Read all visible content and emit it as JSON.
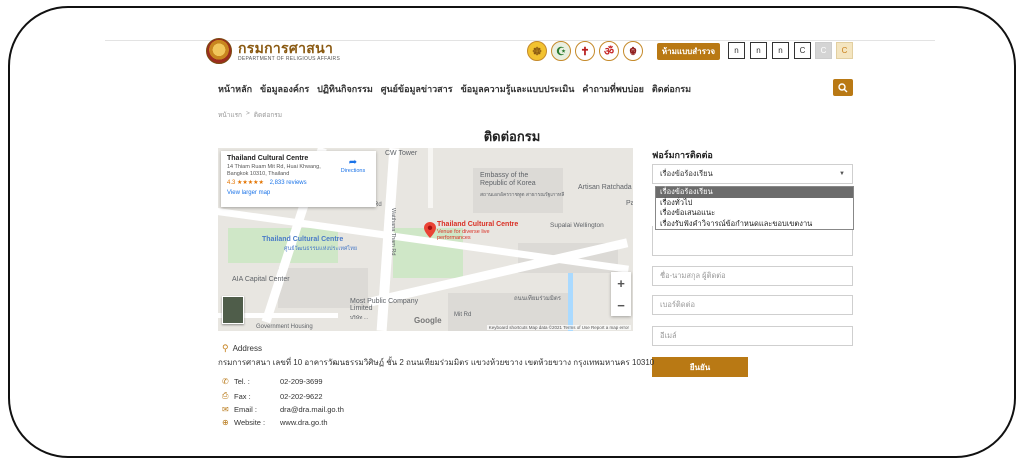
{
  "header": {
    "logo_th": "กรมการศาสนา",
    "logo_en": "DEPARTMENT OF RELIGIOUS AFFAIRS",
    "portal_button": "ห้ามแบบสำรวจ",
    "accessibility": [
      "n",
      "n",
      "n",
      "C",
      "C",
      "C"
    ],
    "religion_icons": [
      "wheel-icon",
      "crescent-icon",
      "cross-icon",
      "om-icon",
      "khanda-icon"
    ]
  },
  "nav": {
    "items": [
      "หน้าหลัก",
      "ข้อมูลองค์กร",
      "ปฏิทินกิจกรรม",
      "ศูนย์ข้อมูลข่าวสาร",
      "ข้อมูลความรู้และแบบประเมิน",
      "คำถามที่พบบ่อย",
      "ติดต่อกรม"
    ]
  },
  "breadcrumb": {
    "home": "หน้าแรก",
    "sep": ">",
    "current": "ติดต่อกรม"
  },
  "page": {
    "title": "ติดต่อกรม"
  },
  "map": {
    "place_name": "Thailand Cultural Centre",
    "place_address": "14 Thiam Ruam Mit Rd, Huai Khwang, Bangkok 10310, Thailand",
    "rating": "4.3",
    "stars": "★★★★★",
    "reviews": "2,833 reviews",
    "directions": "Directions",
    "larger_map": "View larger map",
    "labels": {
      "cw_tower": "CW Tower",
      "embassy": "Embassy of the Republic of Korea",
      "embassy_th": "สถานเอกอัครราชทูต สาธารณรัฐเกาหลี",
      "artisan": "Artisan Ratchada",
      "pa": "Pa",
      "pin_label": "Thailand Cultural Centre",
      "pin_sub": "Venue for diverse live performances",
      "supalai": "Supalai Wellington",
      "tcc_blue": "Thailand Cultural Centre",
      "tcc_blue_th": "ศูนย์วัฒนธรรมแห่งประเทศไทย",
      "aia": "AIA Capital Center",
      "watthana": "Watthana Tham Rd",
      "most": "Most Public Company Limited",
      "most_th": "บริษัท ...",
      "gov": "Government Housing",
      "road_th": "ถนนเทียมร่วมมิตร",
      "mit_rd": "Mit Rd",
      "rd": "Rd",
      "google": "Google"
    },
    "attribution": "Keyboard shortcuts   Map data ©2021   Terms of Use   Report a map error",
    "zoom_in": "+",
    "zoom_out": "−"
  },
  "form": {
    "title": "ฟอร์มการติดต่อ",
    "topic_selected": "เรื่องข้อร้องเรียน",
    "topic_options": [
      "เรื่องข้อร้องเรียน",
      "เรื่องทั่วไป",
      "เรื่องข้อเสนอแนะ",
      "เรื่องรับฟังคำวิจารณ์ข้อกำหนดและขอบเขตงาน"
    ],
    "name_placeholder": "ชื่อ-นามสกุล ผู้ติดต่อ",
    "phone_placeholder": "เบอร์ติดต่อ",
    "email_placeholder": "อีเมล์",
    "submit": "ยืนยัน"
  },
  "contact": {
    "address_label": "Address",
    "address": "กรมการศาสนา เลขที่ 10 อาคารวัฒนธรรมวิศิษฏ์ ชั้น 2 ถนนเทียมร่วมมิตร แขวงห้วยขวาง เขตห้วยขวาง กรุงเทพมหานคร 10310",
    "tel_label": "Tel. :",
    "tel": "02-209-3699",
    "fax_label": "Fax :",
    "fax": "02-202-9622",
    "email_label": "Email :",
    "email": "dra@dra.mail.go.th",
    "website_label": "Website :",
    "website": "www.dra.go.th"
  },
  "colors": {
    "accent": "#b97914",
    "text": "#333333"
  }
}
